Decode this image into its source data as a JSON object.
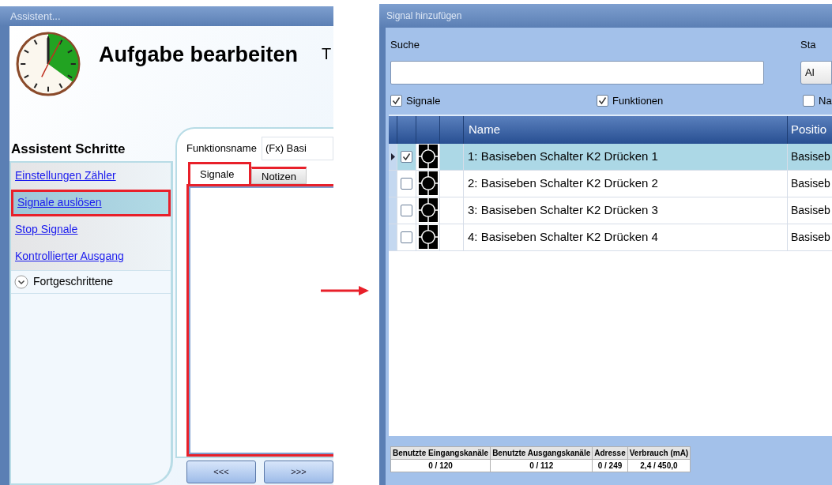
{
  "assistant_window": {
    "title": "Assistent...",
    "heading": "Aufgabe bearbeiten",
    "heading_cut": "T",
    "steps_title": "Assistent Schritte",
    "steps": [
      {
        "label": "Einstellungen Zähler",
        "selected": false
      },
      {
        "label": "Signale auslösen",
        "selected": true
      },
      {
        "label": "Stop Signale",
        "selected": false
      },
      {
        "label": "Kontrollierter Ausgang",
        "selected": false
      }
    ],
    "advanced": {
      "label": "Fortgeschrittene",
      "expanded": false
    },
    "function_name": {
      "label": "Funktionsname",
      "value": "(Fx) Basi"
    },
    "tabs": [
      {
        "label": "Signale",
        "selected": true
      },
      {
        "label": "Notizen",
        "selected": false
      }
    ],
    "buttons": [
      "<<<",
      ">>>"
    ]
  },
  "signal_window": {
    "title": "Signal hinzufügen",
    "search": {
      "label": "Suche"
    },
    "status": {
      "label": "Sta",
      "value": "Al"
    },
    "filters": [
      {
        "label": "Signale",
        "checked": true
      },
      {
        "label": "Funktionen",
        "checked": true
      },
      {
        "label": "Na",
        "checked": false
      }
    ],
    "table": {
      "columns": [
        "Name",
        "Positio"
      ],
      "rows": [
        {
          "name": "1: Basiseben Schalter K2 Drücken 1",
          "position": "Basiseb",
          "checked": true,
          "selected": true
        },
        {
          "name": "2: Basiseben Schalter K2 Drücken 2",
          "position": "Basiseb",
          "checked": false,
          "selected": false
        },
        {
          "name": "3: Basiseben Schalter K2 Drücken 3",
          "position": "Basiseb",
          "checked": false,
          "selected": false
        },
        {
          "name": "4: Basiseben Schalter K2 Drücken 4",
          "position": "Basiseb",
          "checked": false,
          "selected": false
        }
      ]
    },
    "usage": {
      "columns": [
        "Benutzte Eingangskanäle",
        "Benutzte Ausgangskanäle",
        "Adresse",
        "Verbrauch (mA)"
      ],
      "values": [
        "0 / 120",
        "0 / 112",
        "0 / 249",
        "2,4 / 450,0"
      ]
    }
  }
}
